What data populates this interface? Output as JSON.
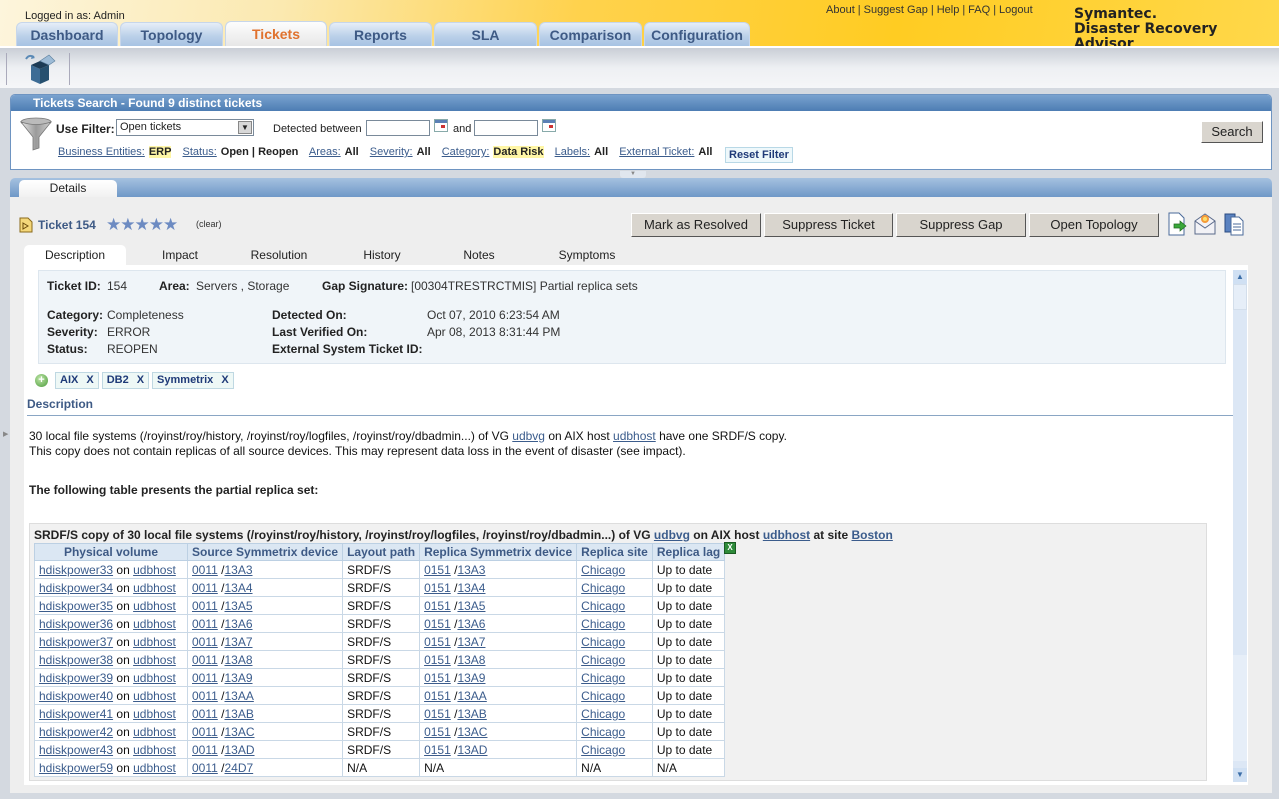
{
  "header": {
    "logged_in": "Logged in as: Admin",
    "links": [
      "About",
      "Suggest Gap",
      "Help",
      "FAQ",
      "Logout"
    ],
    "brand_line1": "Symantec.",
    "brand_line2": "Disaster Recovery Advisor",
    "tabs": [
      {
        "label": "Dashboard",
        "active": false
      },
      {
        "label": "Topology",
        "active": false
      },
      {
        "label": "Tickets",
        "active": true
      },
      {
        "label": "Reports",
        "active": false
      },
      {
        "label": "SLA",
        "active": false
      },
      {
        "label": "Comparison",
        "active": false
      },
      {
        "label": "Configuration",
        "active": false
      }
    ]
  },
  "toolbar": {
    "icon": "open-box-icon"
  },
  "search": {
    "title": "Tickets Search - Found 9 distinct tickets",
    "use_filter_label": "Use Filter:",
    "filter_value": "Open tickets",
    "detected_between_label": "Detected between",
    "and_label": "and",
    "date_from": "",
    "date_to": "",
    "criteria": [
      {
        "key": "Business Entities:",
        "value": "ERP",
        "highlight": true
      },
      {
        "key": "Status:",
        "value": "Open | Reopen",
        "highlight": false
      },
      {
        "key": "Areas:",
        "value": "All",
        "highlight": false
      },
      {
        "key": "Severity:",
        "value": "All",
        "highlight": false
      },
      {
        "key": "Category:",
        "value": "Data Risk",
        "highlight": true
      },
      {
        "key": "Labels:",
        "value": "All",
        "highlight": false
      },
      {
        "key": "External Ticket:",
        "value": "All",
        "highlight": false
      }
    ],
    "reset_label": "Reset Filter",
    "search_label": "Search"
  },
  "details": {
    "tab_label": "Details",
    "ticket_title": "Ticket 154",
    "rating_stars": 5,
    "clear_label": "(clear)",
    "actions": [
      "Mark as Resolved",
      "Suppress Ticket",
      "Suppress Gap",
      "Open Topology"
    ],
    "action_icons": [
      "export-icon",
      "email-icon",
      "copy-icon"
    ],
    "subtabs": [
      {
        "label": "Description",
        "active": true
      },
      {
        "label": "Impact",
        "active": false
      },
      {
        "label": "Resolution",
        "active": false
      },
      {
        "label": "History",
        "active": false
      },
      {
        "label": "Notes",
        "active": false
      },
      {
        "label": "Symptoms",
        "active": false
      }
    ],
    "info": {
      "ticket_id_label": "Ticket ID:",
      "ticket_id": "154",
      "area_label": "Area:",
      "area": "Servers , Storage",
      "gap_label": "Gap Signature:",
      "gap": "[00304TRESTRCTMIS] Partial replica sets",
      "category_label": "Category:",
      "category": "Completeness",
      "severity_label": "Severity:",
      "severity": "ERROR",
      "status_label": "Status:",
      "status": "REOPEN",
      "detected_label": "Detected On:",
      "detected": "Oct 07, 2010 6:23:54 AM",
      "verified_label": "Last Verified On:",
      "verified": "Apr 08, 2013 8:31:44 PM",
      "external_label": "External System Ticket ID:",
      "external": ""
    },
    "tags": [
      "AIX",
      "DB2",
      "Symmetrix"
    ],
    "tag_remove": "X",
    "description_heading": "Description",
    "desc_line1_a": "30 local file systems (/royinst/roy/history, /royinst/roy/logfiles, /royinst/roy/dbadmin...) of VG ",
    "desc_line1_link1": "udbvg",
    "desc_line1_b": " on AIX host ",
    "desc_line1_link2": "udbhost",
    "desc_line1_c": " have one SRDF/S copy.",
    "desc_line2": "This copy does not contain replicas of all source devices. This may represent data loss in the event of disaster (see impact).",
    "table_intro": "The following table presents the partial replica set:",
    "replica": {
      "title_a": "SRDF/S copy of 30 local file systems (/royinst/roy/history, /royinst/roy/logfiles, /royinst/roy/dbadmin...) of VG ",
      "title_vg": "udbvg",
      "title_b": " on AIX host ",
      "title_host": "udbhost",
      "title_c": " at site ",
      "title_site": "Boston",
      "columns": [
        "Physical volume",
        "Source Symmetrix device",
        "Layout path",
        "Replica Symmetrix device",
        "Replica site",
        "Replica lag"
      ],
      "on_word": "on",
      "rows": [
        {
          "pv": "hdiskpower33",
          "host": "udbhost",
          "src_sym": "0011",
          "src_dev": "13A3",
          "path": "SRDF/S",
          "rep_sym": "0151",
          "rep_dev": "13A3",
          "site": "Chicago",
          "lag": "Up to date"
        },
        {
          "pv": "hdiskpower34",
          "host": "udbhost",
          "src_sym": "0011",
          "src_dev": "13A4",
          "path": "SRDF/S",
          "rep_sym": "0151",
          "rep_dev": "13A4",
          "site": "Chicago",
          "lag": "Up to date"
        },
        {
          "pv": "hdiskpower35",
          "host": "udbhost",
          "src_sym": "0011",
          "src_dev": "13A5",
          "path": "SRDF/S",
          "rep_sym": "0151",
          "rep_dev": "13A5",
          "site": "Chicago",
          "lag": "Up to date"
        },
        {
          "pv": "hdiskpower36",
          "host": "udbhost",
          "src_sym": "0011",
          "src_dev": "13A6",
          "path": "SRDF/S",
          "rep_sym": "0151",
          "rep_dev": "13A6",
          "site": "Chicago",
          "lag": "Up to date"
        },
        {
          "pv": "hdiskpower37",
          "host": "udbhost",
          "src_sym": "0011",
          "src_dev": "13A7",
          "path": "SRDF/S",
          "rep_sym": "0151",
          "rep_dev": "13A7",
          "site": "Chicago",
          "lag": "Up to date"
        },
        {
          "pv": "hdiskpower38",
          "host": "udbhost",
          "src_sym": "0011",
          "src_dev": "13A8",
          "path": "SRDF/S",
          "rep_sym": "0151",
          "rep_dev": "13A8",
          "site": "Chicago",
          "lag": "Up to date"
        },
        {
          "pv": "hdiskpower39",
          "host": "udbhost",
          "src_sym": "0011",
          "src_dev": "13A9",
          "path": "SRDF/S",
          "rep_sym": "0151",
          "rep_dev": "13A9",
          "site": "Chicago",
          "lag": "Up to date"
        },
        {
          "pv": "hdiskpower40",
          "host": "udbhost",
          "src_sym": "0011",
          "src_dev": "13AA",
          "path": "SRDF/S",
          "rep_sym": "0151",
          "rep_dev": "13AA",
          "site": "Chicago",
          "lag": "Up to date"
        },
        {
          "pv": "hdiskpower41",
          "host": "udbhost",
          "src_sym": "0011",
          "src_dev": "13AB",
          "path": "SRDF/S",
          "rep_sym": "0151",
          "rep_dev": "13AB",
          "site": "Chicago",
          "lag": "Up to date"
        },
        {
          "pv": "hdiskpower42",
          "host": "udbhost",
          "src_sym": "0011",
          "src_dev": "13AC",
          "path": "SRDF/S",
          "rep_sym": "0151",
          "rep_dev": "13AC",
          "site": "Chicago",
          "lag": "Up to date"
        },
        {
          "pv": "hdiskpower43",
          "host": "udbhost",
          "src_sym": "0011",
          "src_dev": "13AD",
          "path": "SRDF/S",
          "rep_sym": "0151",
          "rep_dev": "13AD",
          "site": "Chicago",
          "lag": "Up to date"
        },
        {
          "pv": "hdiskpower59",
          "host": "udbhost",
          "src_sym": "0011",
          "src_dev": "24D7",
          "path": "N/A",
          "rep_sym": "",
          "rep_dev": "",
          "rep_na": "N/A",
          "site": "",
          "site_na": "N/A",
          "lag": "N/A"
        }
      ]
    }
  }
}
